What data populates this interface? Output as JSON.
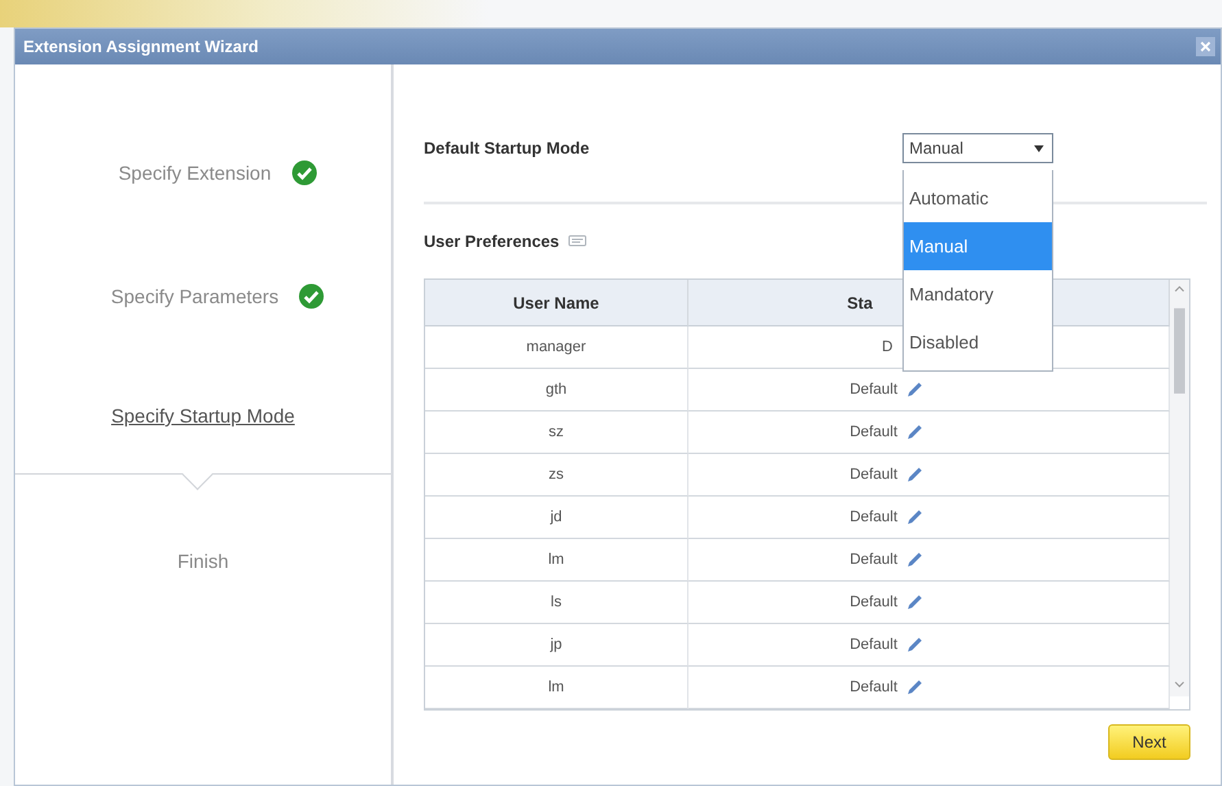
{
  "window": {
    "title": "Extension Assignment Wizard"
  },
  "steps": [
    {
      "label": "Specify Extension",
      "done": true,
      "current": false
    },
    {
      "label": "Specify Parameters",
      "done": true,
      "current": false
    },
    {
      "label": "Specify Startup Mode",
      "done": false,
      "current": true
    },
    {
      "label": "Finish",
      "done": false,
      "current": false
    }
  ],
  "startup_mode": {
    "label": "Default Startup Mode",
    "value": "Manual",
    "options": [
      {
        "label": "Automatic",
        "selected": false
      },
      {
        "label": "Manual",
        "selected": true
      },
      {
        "label": "Mandatory",
        "selected": false
      },
      {
        "label": "Disabled",
        "selected": false
      }
    ]
  },
  "user_preferences": {
    "title": "User Preferences",
    "columns": [
      "User Name",
      "Sta"
    ],
    "rows": [
      {
        "user": "manager",
        "status": "D",
        "editable": false
      },
      {
        "user": "gth",
        "status": "Default",
        "editable": true
      },
      {
        "user": "sz",
        "status": "Default",
        "editable": true
      },
      {
        "user": "zs",
        "status": "Default",
        "editable": true
      },
      {
        "user": "jd",
        "status": "Default",
        "editable": true
      },
      {
        "user": "lm",
        "status": "Default",
        "editable": true
      },
      {
        "user": "ls",
        "status": "Default",
        "editable": true
      },
      {
        "user": "jp",
        "status": "Default",
        "editable": true
      },
      {
        "user": "lm",
        "status": "Default",
        "editable": true
      }
    ]
  },
  "buttons": [
    "Next"
  ]
}
